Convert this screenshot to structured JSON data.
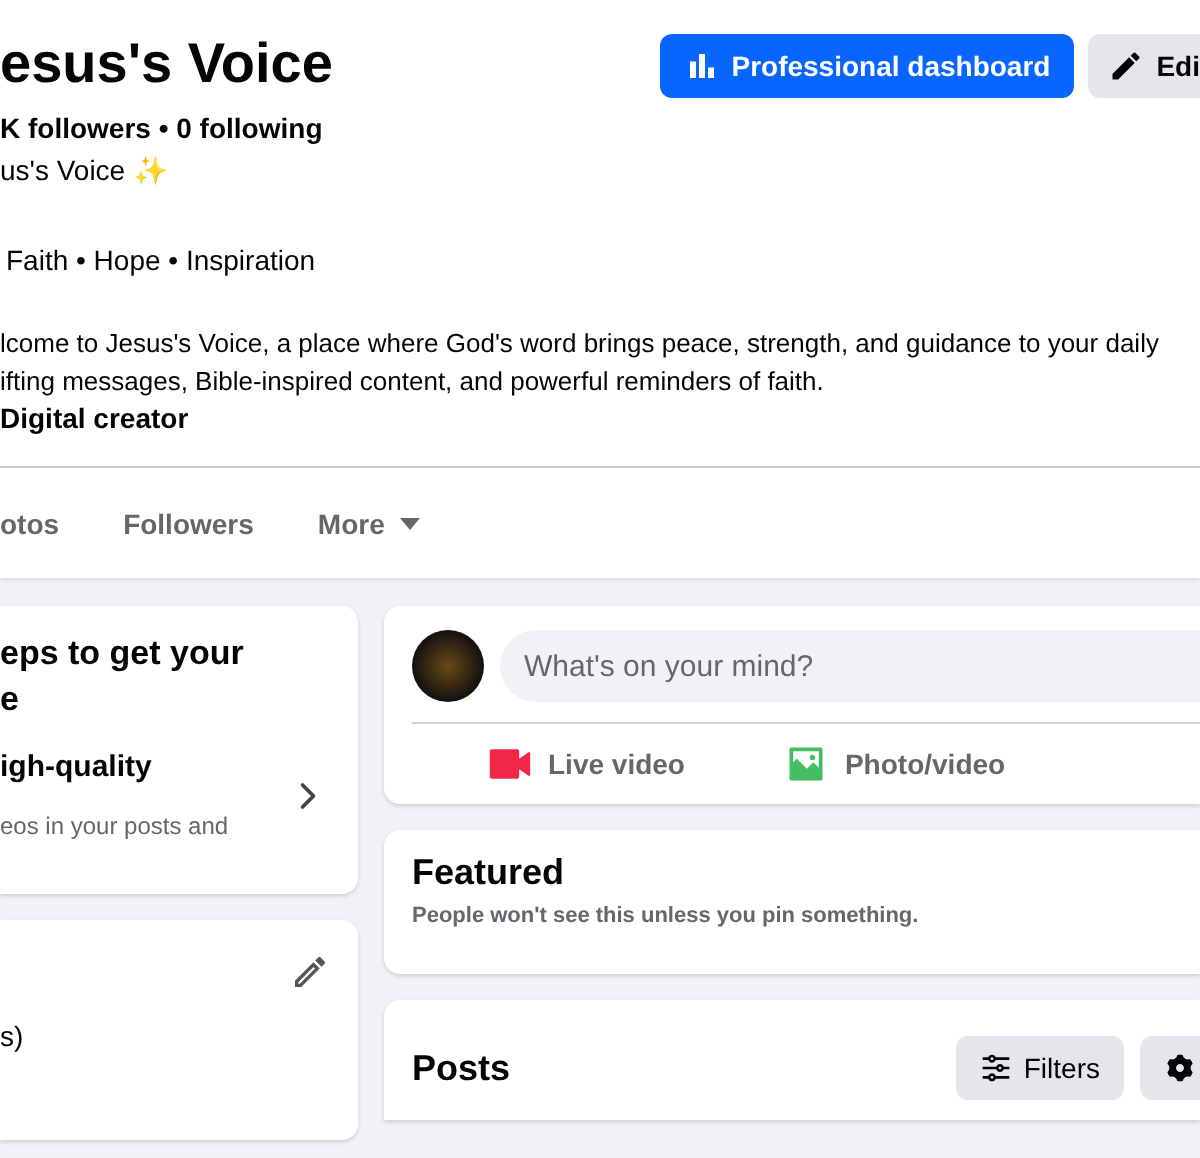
{
  "profile": {
    "name": "esus's Voice",
    "stats": "K followers • 0 following",
    "tagline": "us's Voice ✨",
    "motto": "Faith • Hope • Inspiration",
    "bio": [
      "lcome to Jesus's Voice, a place where God's word brings peace, strength, and guidance to your daily",
      "ifting messages, Bible-inspired content, and powerful reminders of faith."
    ],
    "category": "Digital creator"
  },
  "actions": [
    {
      "label": "Professional dashboard",
      "kind": "primary"
    },
    {
      "label": "Edi",
      "kind": "secondary"
    }
  ],
  "tabs": [
    {
      "label": "otos",
      "selected": false,
      "dropdown": false
    },
    {
      "label": "Followers",
      "selected": false,
      "dropdown": false
    },
    {
      "label": "More",
      "selected": false,
      "dropdown": true
    }
  ],
  "setup_card": {
    "title": "eps to get your\ne",
    "step_title": "igh-quality",
    "step_text": "eos in your posts and"
  },
  "details_card": {
    "text": "s)"
  },
  "composer": {
    "placeholder": "What's on your mind?",
    "options": [
      {
        "label": "Live video",
        "kind": "live"
      },
      {
        "label": "Photo/video",
        "kind": "photo"
      }
    ]
  },
  "featured": {
    "title": "Featured",
    "text": "People won't see this unless you pin something."
  },
  "posts": {
    "title": "Posts",
    "filter_label": "Filters"
  }
}
